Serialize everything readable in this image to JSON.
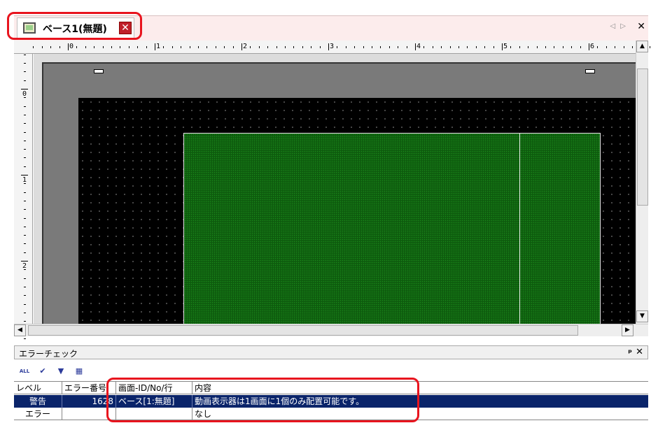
{
  "tab": {
    "title": "ベース1(無題)",
    "close": "✕"
  },
  "tabbar": {
    "scroll": "◁ ▷",
    "close": "✕"
  },
  "ruler": {
    "h": [
      "0",
      "1",
      "2",
      "3",
      "4",
      "5",
      "6"
    ],
    "v": [
      "0",
      "1",
      "2"
    ]
  },
  "scroll": {
    "up": "▲",
    "down": "▼",
    "left": "◀",
    "right": "▶"
  },
  "error_panel": {
    "title": "エラーチェック",
    "pin": "ᵖ",
    "close": "✕",
    "toolbar": {
      "all": "ALL",
      "check": "✔",
      "filter": "▼",
      "list": "▦"
    },
    "columns": [
      "レベル",
      "エラー番号",
      "画面-ID/No/行",
      "内容"
    ],
    "rows": [
      {
        "level": "警告",
        "number": "1628",
        "screen": "ベース[1:無題]",
        "content": "動画表示器は1画面に1個のみ配置可能です。"
      },
      {
        "level": "エラー",
        "number": "",
        "screen": "",
        "content": "なし"
      }
    ]
  }
}
